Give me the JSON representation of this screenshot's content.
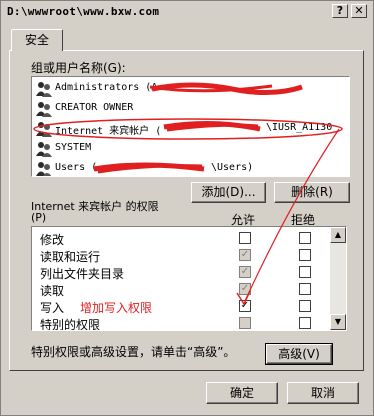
{
  "window": {
    "title": "D:\\wwwroot\\www.bxw.com",
    "help_button": "?",
    "close_button": "✕"
  },
  "tabs": [
    {
      "label": "安全"
    }
  ],
  "users_label": "组或用户名称(G):",
  "users": [
    {
      "name": "Administrators (A",
      "icon": "user-group-icon"
    },
    {
      "name": "CREATOR OWNER",
      "icon": "user-group-icon"
    },
    {
      "name": "Internet 来宾帐户 (",
      "suffix": "\\IUSR_A1130",
      "icon": "user-group-icon"
    },
    {
      "name": "SYSTEM",
      "icon": "user-group-icon"
    },
    {
      "name": "Users (",
      "suffix": "\\Users)",
      "icon": "user-group-icon"
    }
  ],
  "buttons": {
    "add": "添加(D)...",
    "remove": "删除(R)",
    "advanced": "高级(V)",
    "ok": "确定",
    "cancel": "取消"
  },
  "permissions": {
    "label_line1": "Internet 来宾帐户 的权限",
    "label_line2": "(P)",
    "col_allow": "允许",
    "col_deny": "拒绝",
    "rows": [
      {
        "name": "修改",
        "allow": false,
        "deny": false,
        "allow_disabled": false
      },
      {
        "name": "读取和运行",
        "allow": true,
        "deny": false,
        "allow_disabled": true
      },
      {
        "name": "列出文件夹目录",
        "allow": true,
        "deny": false,
        "allow_disabled": true
      },
      {
        "name": "读取",
        "allow": true,
        "deny": false,
        "allow_disabled": true
      },
      {
        "name": "写入",
        "allow": true,
        "deny": false,
        "allow_disabled": false
      },
      {
        "name": "特别的权限",
        "allow": false,
        "deny": false,
        "allow_disabled": true
      }
    ]
  },
  "annotation": {
    "text": "增加写入权限",
    "color": "#e02020"
  },
  "advanced_hint": "特别权限或高级设置，请单击“高级”。"
}
